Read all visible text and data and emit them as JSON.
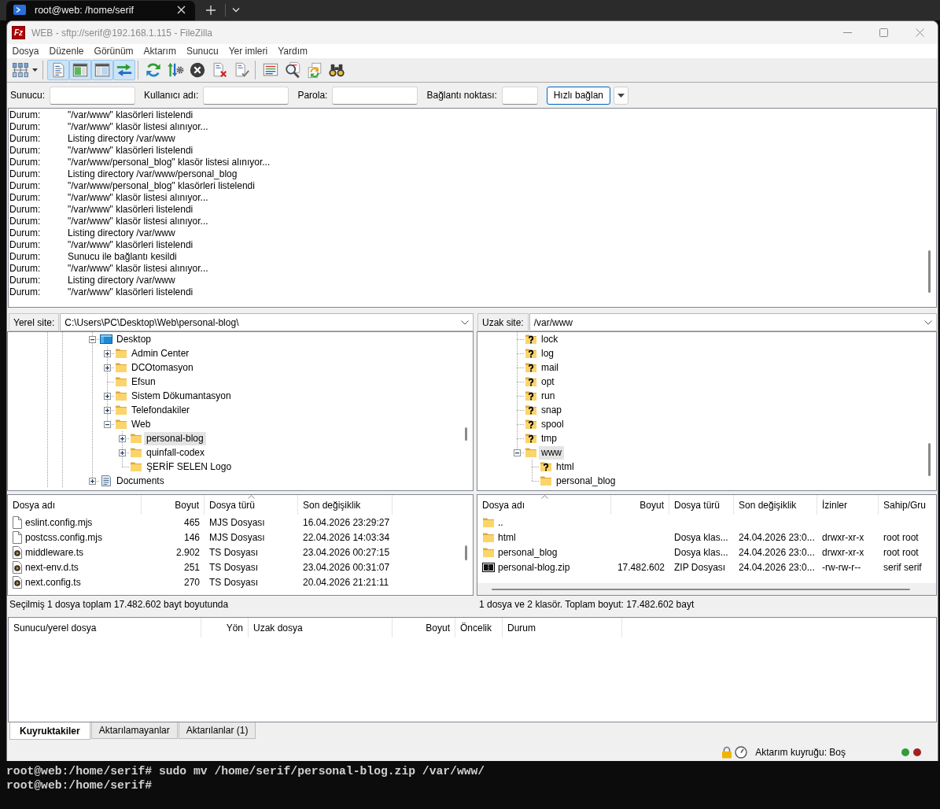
{
  "terminal_tab": {
    "title": "root@web: /home/serif",
    "selected": true
  },
  "window": {
    "logo": "Fz",
    "title": "WEB - sftp://serif@192.168.1.115 - FileZilla"
  },
  "menu": [
    "Dosya",
    "Düzenle",
    "Görünüm",
    "Aktarım",
    "Sunucu",
    "Yer imleri",
    "Yardım"
  ],
  "toolbar": {
    "groups": [
      [
        {
          "kind": "site-manager",
          "pressed": false
        }
      ],
      [
        {
          "kind": "message-log",
          "pressed": true
        },
        {
          "kind": "local-tree",
          "pressed": true
        },
        {
          "kind": "remote-tree",
          "pressed": true
        },
        {
          "kind": "transfer-queue",
          "pressed": true
        }
      ],
      [
        {
          "kind": "refresh",
          "pressed": false
        },
        {
          "kind": "process-queue",
          "pressed": false
        },
        {
          "kind": "cancel",
          "pressed": false
        },
        {
          "kind": "disconnect",
          "pressed": false
        },
        {
          "kind": "reconnect",
          "pressed": false
        }
      ],
      [
        {
          "kind": "filter",
          "pressed": false
        },
        {
          "kind": "search",
          "pressed": false
        },
        {
          "kind": "sync-browsing",
          "pressed": false
        },
        {
          "kind": "compare",
          "pressed": false
        }
      ]
    ]
  },
  "quickconnect": {
    "fields": [
      {
        "label": "Sunucu:"
      },
      {
        "label": "Kullanıcı adı:"
      },
      {
        "label": "Parola:"
      },
      {
        "label": "Bağlantı noktası:"
      }
    ],
    "button": "Hızlı bağlan"
  },
  "log": [
    {
      "prefix": "Durum:",
      "message": "\"/var/www\" klasörleri listelendi"
    },
    {
      "prefix": "Durum:",
      "message": "\"/var/www\" klasör listesi alınıyor..."
    },
    {
      "prefix": "Durum:",
      "message": "Listing directory /var/www"
    },
    {
      "prefix": "Durum:",
      "message": "\"/var/www\" klasörleri listelendi"
    },
    {
      "prefix": "Durum:",
      "message": "\"/var/www/personal_blog\" klasör listesi alınıyor..."
    },
    {
      "prefix": "Durum:",
      "message": "Listing directory /var/www/personal_blog"
    },
    {
      "prefix": "Durum:",
      "message": "\"/var/www/personal_blog\" klasörleri listelendi"
    },
    {
      "prefix": "Durum:",
      "message": "\"/var/www\" klasör listesi alınıyor..."
    },
    {
      "prefix": "Durum:",
      "message": "\"/var/www\" klasörleri listelendi"
    },
    {
      "prefix": "Durum:",
      "message": "\"/var/www\" klasör listesi alınıyor..."
    },
    {
      "prefix": "Durum:",
      "message": "Listing directory /var/www"
    },
    {
      "prefix": "Durum:",
      "message": "\"/var/www\" klasörleri listelendi"
    },
    {
      "prefix": "Durum:",
      "message": "Sunucu ile bağlantı kesildi"
    },
    {
      "prefix": "Durum:",
      "message": "\"/var/www\" klasör listesi alınıyor..."
    },
    {
      "prefix": "Durum:",
      "message": "Listing directory /var/www"
    },
    {
      "prefix": "Durum:",
      "message": "\"/var/www\" klasörleri listelendi"
    }
  ],
  "local": {
    "site_label": "Yerel site:",
    "path": "C:\\Users\\PC\\Desktop\\Web\\personal-blog\\",
    "tree": [
      {
        "label": "Desktop",
        "kind": "desktop",
        "expandable": true,
        "expanded": true,
        "selected": false,
        "children": [
          {
            "label": "Admin Center",
            "kind": "folder",
            "expandable": true,
            "expanded": false,
            "selected": false
          },
          {
            "label": "DCOtomasyon",
            "kind": "folder",
            "expandable": true,
            "expanded": false,
            "selected": false
          },
          {
            "label": "Efsun",
            "kind": "folder",
            "expandable": false,
            "selected": false
          },
          {
            "label": "Sistem Dökumantasyon",
            "kind": "folder",
            "expandable": true,
            "expanded": false,
            "selected": false
          },
          {
            "label": "Telefondakiler",
            "kind": "folder",
            "expandable": true,
            "expanded": false,
            "selected": false
          },
          {
            "label": "Web",
            "kind": "folder",
            "expandable": true,
            "expanded": true,
            "selected": false,
            "children": [
              {
                "label": "personal-blog",
                "kind": "folder",
                "expandable": true,
                "expanded": false,
                "selected": true
              },
              {
                "label": "quinfall-codex",
                "kind": "folder",
                "expandable": true,
                "expanded": false,
                "selected": false
              },
              {
                "label": "ŞERİF SELEN Logo",
                "kind": "folder",
                "expandable": false,
                "selected": false
              }
            ]
          }
        ]
      },
      {
        "label": "Documents",
        "kind": "documents",
        "expandable": true,
        "expanded": false,
        "selected": false
      }
    ],
    "files": {
      "columns": [
        {
          "label": "Dosya adı",
          "sorted": false
        },
        {
          "label": "Boyut",
          "sorted": false
        },
        {
          "label": "Dosya türü",
          "sorted": true
        },
        {
          "label": "Son değişiklik",
          "sorted": false
        }
      ],
      "rows": [
        {
          "kind": "plain",
          "selected": false,
          "name": "eslint.config.mjs",
          "size": "465",
          "type": "MJS Dosyası",
          "modified": "16.04.2026 23:29:27"
        },
        {
          "kind": "plain",
          "selected": false,
          "name": "postcss.config.mjs",
          "size": "146",
          "type": "MJS Dosyası",
          "modified": "22.04.2026 14:03:34"
        },
        {
          "kind": "play",
          "selected": false,
          "name": "middleware.ts",
          "size": "2.902",
          "type": "TS Dosyası",
          "modified": "23.04.2026 00:27:15"
        },
        {
          "kind": "play",
          "selected": false,
          "name": "next-env.d.ts",
          "size": "251",
          "type": "TS Dosyası",
          "modified": "23.04.2026 00:31:07"
        },
        {
          "kind": "play",
          "selected": false,
          "name": "next.config.ts",
          "size": "270",
          "type": "TS Dosyası",
          "modified": "20.04.2026 21:21:11"
        }
      ]
    },
    "status": "Seçilmiş 1 dosya toplam 17.482.602 bayt boyutunda"
  },
  "remote": {
    "site_label": "Uzak site:",
    "path": "/var/www",
    "tree": [
      {
        "label": "lock",
        "kind": "unknown",
        "expandable": false,
        "selected": false
      },
      {
        "label": "log",
        "kind": "unknown",
        "expandable": false,
        "selected": false
      },
      {
        "label": "mail",
        "kind": "unknown",
        "expandable": false,
        "selected": false
      },
      {
        "label": "opt",
        "kind": "unknown",
        "expandable": false,
        "selected": false
      },
      {
        "label": "run",
        "kind": "unknown",
        "expandable": false,
        "selected": false
      },
      {
        "label": "snap",
        "kind": "unknown",
        "expandable": false,
        "selected": false
      },
      {
        "label": "spool",
        "kind": "unknown",
        "expandable": false,
        "selected": false
      },
      {
        "label": "tmp",
        "kind": "unknown",
        "expandable": false,
        "selected": false
      },
      {
        "label": "www",
        "kind": "folder",
        "expandable": true,
        "expanded": true,
        "selected": true,
        "children": [
          {
            "label": "html",
            "kind": "unknown",
            "expandable": false,
            "selected": false
          },
          {
            "label": "personal_blog",
            "kind": "folder",
            "expandable": false,
            "selected": false
          }
        ]
      }
    ],
    "files": {
      "columns": [
        {
          "label": "Dosya adı",
          "sorted": true
        },
        {
          "label": "Boyut",
          "sorted": false
        },
        {
          "label": "Dosya türü",
          "sorted": false
        },
        {
          "label": "Son değişiklik",
          "sorted": false
        },
        {
          "label": "İzinler",
          "sorted": false
        },
        {
          "label": "Sahip/Gru",
          "sorted": false
        }
      ],
      "rows": [
        {
          "kind": "folder",
          "selected": false,
          "name": ".."
        },
        {
          "kind": "folder",
          "selected": false,
          "name": "html",
          "type": "Dosya klas...",
          "modified": "24.04.2026 23:0...",
          "permissions": "drwxr-xr-x",
          "owner": "root root"
        },
        {
          "kind": "folder",
          "selected": false,
          "name": "personal_blog",
          "type": "Dosya klas...",
          "modified": "24.04.2026 23:0...",
          "permissions": "drwxr-xr-x",
          "owner": "root root"
        },
        {
          "kind": "archive",
          "selected": false,
          "name": "personal-blog.zip",
          "size": "17.482.602",
          "type": "ZIP Dosyası",
          "modified": "24.04.2026 23:0...",
          "permissions": "-rw-rw-r--",
          "owner": "serif serif"
        }
      ]
    },
    "status": "1 dosya ve 2 klasör. Toplam boyut: 17.482.602 bayt"
  },
  "queue": {
    "columns": [
      "Sunucu/yerel dosya",
      "Yön",
      "Uzak dosya",
      "Boyut",
      "Öncelik",
      "Durum"
    ],
    "tabs": [
      {
        "label": "Kuyruktakiler",
        "selected": true
      },
      {
        "label": "Aktarılamayanlar",
        "selected": false
      },
      {
        "label": "Aktarılanlar (1)",
        "selected": false
      }
    ]
  },
  "status_bar": {
    "queue_text": "Aktarım kuyruğu: Boş",
    "indicators": [
      {
        "color": "#2e9e3a"
      },
      {
        "color": "#a32020"
      }
    ]
  },
  "terminal_lines": [
    "root@web:/home/serif# sudo mv /home/serif/personal-blog.zip /var/www/",
    "root@web:/home/serif#"
  ]
}
